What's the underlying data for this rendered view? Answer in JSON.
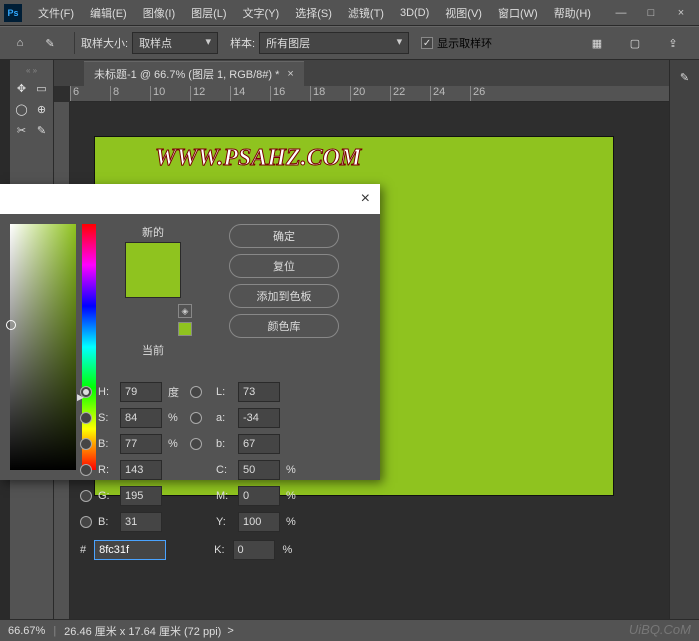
{
  "app": {
    "logo": "Ps"
  },
  "menu": {
    "file": "文件(F)",
    "edit": "编辑(E)",
    "image": "图像(I)",
    "layer": "图层(L)",
    "type": "文字(Y)",
    "select": "选择(S)",
    "filter": "滤镜(T)",
    "view3d": "3D(D)",
    "view": "视图(V)",
    "window": "窗口(W)",
    "help": "帮助(H)"
  },
  "window_controls": {
    "min": "—",
    "max": "□",
    "close": "×"
  },
  "options": {
    "sample_size_label": "取样大小:",
    "sample_size_value": "取样点",
    "sample_label": "样本:",
    "sample_value": "所有图层",
    "show_ring": "显示取样环"
  },
  "doc": {
    "tab_title": "未标题-1 @ 66.7% (图层 1, RGB/8#) *"
  },
  "ruler": {
    "ticks": [
      "6",
      "8",
      "10",
      "12",
      "14",
      "16",
      "18",
      "20",
      "22",
      "24",
      "26"
    ]
  },
  "canvas": {
    "bg": "#8fc31f",
    "watermark": "WWW.PSAHZ.COM"
  },
  "status": {
    "zoom": "66.67%",
    "dims": "26.46 厘米 x 17.64 厘米 (72 ppi)",
    "arrow": ">"
  },
  "footer": "UiBQ.CoM",
  "picker": {
    "close": "×",
    "new_label": "新的",
    "current_label": "当前",
    "btn_ok": "确定",
    "btn_reset": "复位",
    "btn_add": "添加到色板",
    "btn_lib": "颜色库",
    "labels": {
      "h": "H:",
      "s": "S:",
      "b": "B:",
      "r": "R:",
      "g": "G:",
      "b2": "B:",
      "l": "L:",
      "a": "a:",
      "b3": "b:",
      "c": "C:",
      "m": "M:",
      "y": "Y:",
      "k": "K:",
      "pct": "%",
      "deg": "度",
      "hash": "#"
    },
    "vals": {
      "h": "79",
      "s": "84",
      "b": "77",
      "r": "143",
      "g": "195",
      "b2": "31",
      "l": "73",
      "a": "-34",
      "b3": "67",
      "c": "50",
      "m": "0",
      "y": "100",
      "k": "0",
      "hex": "8fc31f"
    }
  }
}
